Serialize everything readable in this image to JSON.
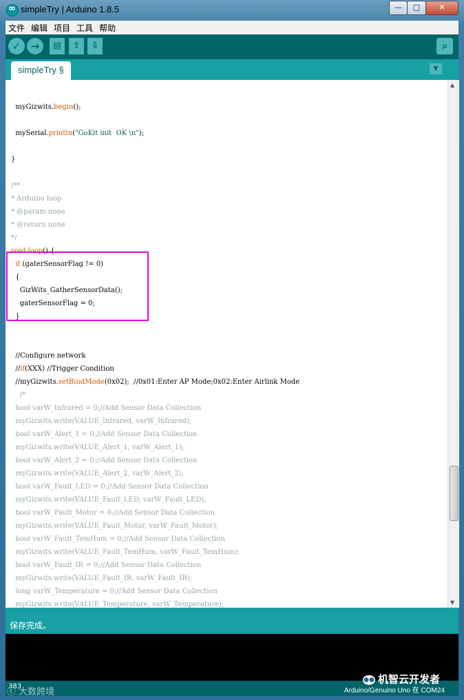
{
  "window": {
    "title": "simpleTry | Arduino 1.8.5",
    "controls": {
      "minimize": "—",
      "maximize": "□",
      "close": "✕"
    }
  },
  "menu": [
    "文件",
    "编辑",
    "项目",
    "工具",
    "帮助"
  ],
  "toolbar": {
    "icons": [
      "verify-icon",
      "upload-icon",
      "new-icon",
      "open-icon",
      "save-icon",
      "serial-monitor-icon"
    ]
  },
  "tab": {
    "label": "simpleTry §"
  },
  "code_lines": [
    {
      "text": "",
      "cls": ""
    },
    {
      "text": "  myGizwits.begin();",
      "cls": ""
    },
    {
      "text": "",
      "cls": ""
    },
    {
      "text": "  mySerial.println(\"GoKit init  OK \\n\");",
      "cls": ""
    },
    {
      "text": "",
      "cls": ""
    },
    {
      "text": "}",
      "cls": ""
    },
    {
      "text": "",
      "cls": ""
    },
    {
      "text": "/**",
      "cls": "cm"
    },
    {
      "text": "* Arduino loop",
      "cls": "cm"
    },
    {
      "text": "* @param none",
      "cls": "cm"
    },
    {
      "text": "* @return none",
      "cls": "cm"
    },
    {
      "text": "*/",
      "cls": "cm"
    },
    {
      "text": "void loop() {",
      "cls": ""
    },
    {
      "text": "  if (gaterSensorFlag != 0)",
      "cls": ""
    },
    {
      "text": "  {",
      "cls": ""
    },
    {
      "text": "    GizWits_GatherSensorData();",
      "cls": ""
    },
    {
      "text": "    gaterSensorFlag = 0;",
      "cls": ""
    },
    {
      "text": "  }",
      "cls": ""
    },
    {
      "text": "",
      "cls": ""
    },
    {
      "text": "",
      "cls": ""
    },
    {
      "text": "  //Configure network",
      "cls": ""
    },
    {
      "text": "  //if(XXX) //Trigger Condition",
      "cls": ""
    },
    {
      "text": "  //myGizwits.setBindMode(0x02);  //0x01:Enter AP Mode;0x02:Enter Airlink Mode",
      "cls": ""
    },
    {
      "text": "    /*",
      "cls": "cm"
    },
    {
      "text": "  bool varW_Infrared = 0;//Add Sensor Data Collection",
      "cls": "cm"
    },
    {
      "text": "  myGizwits.write(VALUE_Infrared, varW_Infrared);",
      "cls": "cm"
    },
    {
      "text": "  bool varW_Alert_1 = 0;//Add Sensor Data Collection",
      "cls": "cm"
    },
    {
      "text": "  myGizwits.write(VALUE_Alert_1, varW_Alert_1);",
      "cls": "cm"
    },
    {
      "text": "  bool varW_Alert_2 = 0;//Add Sensor Data Collection",
      "cls": "cm"
    },
    {
      "text": "  myGizwits.write(VALUE_Alert_2, varW_Alert_2);",
      "cls": "cm"
    },
    {
      "text": "  bool varW_Fault_LED = 0;//Add Sensor Data Collection",
      "cls": "cm"
    },
    {
      "text": "  myGizwits.write(VALUE_Fault_LED, varW_Fault_LED);",
      "cls": "cm"
    },
    {
      "text": "  bool varW_Fault_Motor = 0;//Add Sensor Data Collection",
      "cls": "cm"
    },
    {
      "text": "  myGizwits.write(VALUE_Fault_Motor, varW_Fault_Motor);",
      "cls": "cm"
    },
    {
      "text": "  bool varW_Fault_TemHum = 0;//Add Sensor Data Collection",
      "cls": "cm"
    },
    {
      "text": "  myGizwits.write(VALUE_Fault_TemHum, varW_Fault_TemHum);",
      "cls": "cm"
    },
    {
      "text": "  bool varW_Fault_IR = 0;//Add Sensor Data Collection",
      "cls": "cm"
    },
    {
      "text": "  myGizwits.write(VALUE_Fault_IR, varW_Fault_IR);",
      "cls": "cm"
    },
    {
      "text": "  long varW_Temperature = 0;//Add Sensor Data Collection",
      "cls": "cm"
    },
    {
      "text": "  myGizwits.write(VALUE_Temperature, varW_Temperature);",
      "cls": "cm"
    }
  ],
  "status": {
    "message": "保存完成。"
  },
  "footer": {
    "line": "383",
    "board": "Arduino/Genuino Uno 在 COM24"
  },
  "watermark": {
    "left": "大数跨境",
    "right": "机智云开发者"
  },
  "colors": {
    "highlight": "#e600e6",
    "teal": "#006468",
    "teal_light": "#17a1a5"
  }
}
